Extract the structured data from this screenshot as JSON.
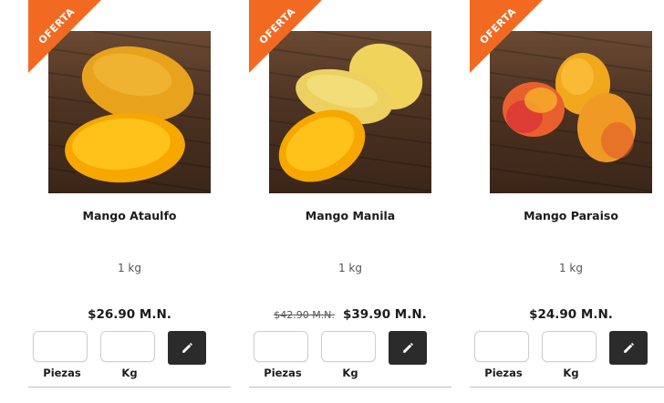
{
  "products": [
    {
      "badge": "OFERTA",
      "name": "Mango Ataulfo",
      "weight": "1 kg",
      "old_price": "",
      "price": "$26.90 M.N.",
      "qty_labels": {
        "pieces": "Piezas",
        "kg": "Kg"
      },
      "inputs": {
        "pieces_value": "",
        "kg_value": ""
      },
      "edit_icon": "pencil-icon"
    },
    {
      "badge": "OFERTA",
      "name": "Mango Manila",
      "weight": "1 kg",
      "old_price": "$42.90 M.N.",
      "price": "$39.90 M.N.",
      "qty_labels": {
        "pieces": "Piezas",
        "kg": "Kg"
      },
      "inputs": {
        "pieces_value": "",
        "kg_value": ""
      },
      "edit_icon": "pencil-icon"
    },
    {
      "badge": "OFERTA",
      "name": "Mango Paraiso",
      "weight": "1 kg",
      "old_price": "",
      "price": "$24.90 M.N.",
      "qty_labels": {
        "pieces": "Piezas",
        "kg": "Kg"
      },
      "inputs": {
        "pieces_value": "",
        "kg_value": ""
      },
      "edit_icon": "pencil-icon"
    }
  ],
  "colors": {
    "badge": "#f26a21",
    "edit_button": "#2b2b2b",
    "divider": "#bdbdbd"
  }
}
